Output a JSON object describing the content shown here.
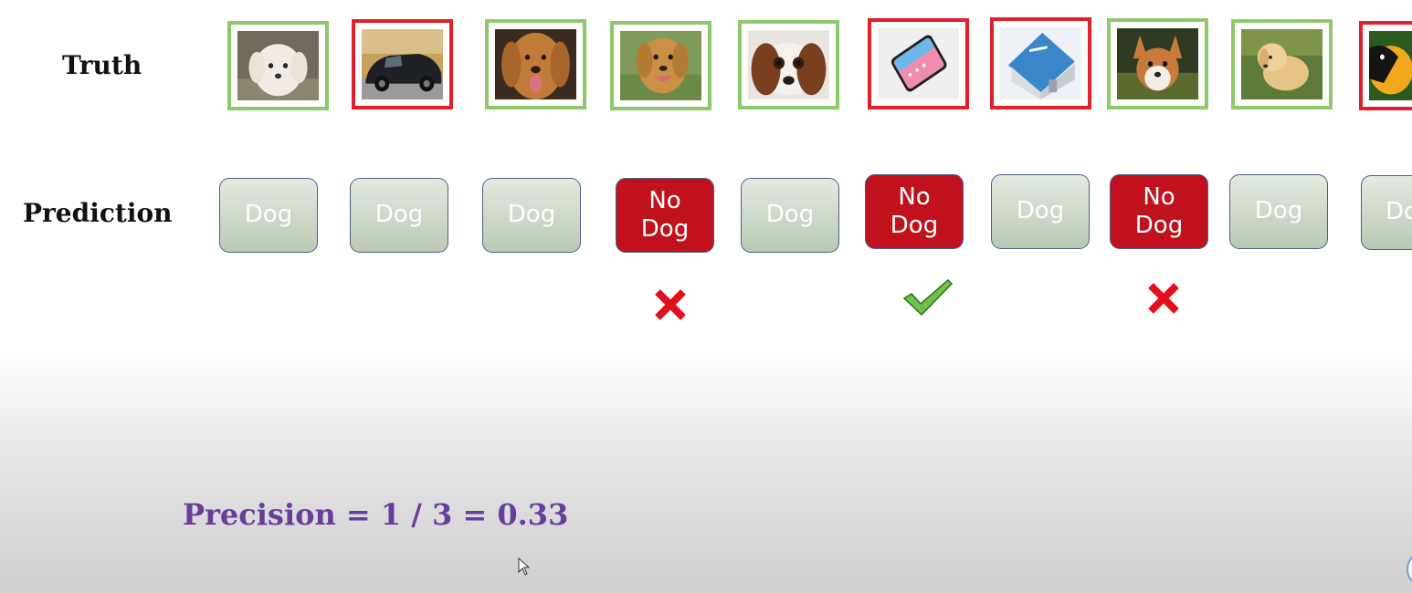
{
  "labels": {
    "truth": "Truth",
    "prediction": "Prediction"
  },
  "predictions": [
    {
      "lines": [
        "Dog"
      ]
    },
    {
      "lines": [
        "Dog"
      ]
    },
    {
      "lines": [
        "Dog"
      ]
    },
    {
      "lines": [
        "No",
        "Dog"
      ]
    },
    {
      "lines": [
        "Dog"
      ]
    },
    {
      "lines": [
        "No",
        "Dog"
      ]
    },
    {
      "lines": [
        "Dog"
      ]
    },
    {
      "lines": [
        "No",
        "Dog"
      ]
    },
    {
      "lines": [
        "Dog"
      ]
    },
    {
      "lines": [
        "Dog"
      ]
    }
  ],
  "formula": "Precision = 1 / 3 = 0.33",
  "icons": {
    "wrong": "cross-icon",
    "correct": "checkmark-icon",
    "cursor": "mouse-pointer-icon"
  },
  "colors": {
    "positive_border": "#8dc96a",
    "negative_border": "#e0202a",
    "no_dog_fill": "#c0111c",
    "formula": "#6a3d9a"
  }
}
